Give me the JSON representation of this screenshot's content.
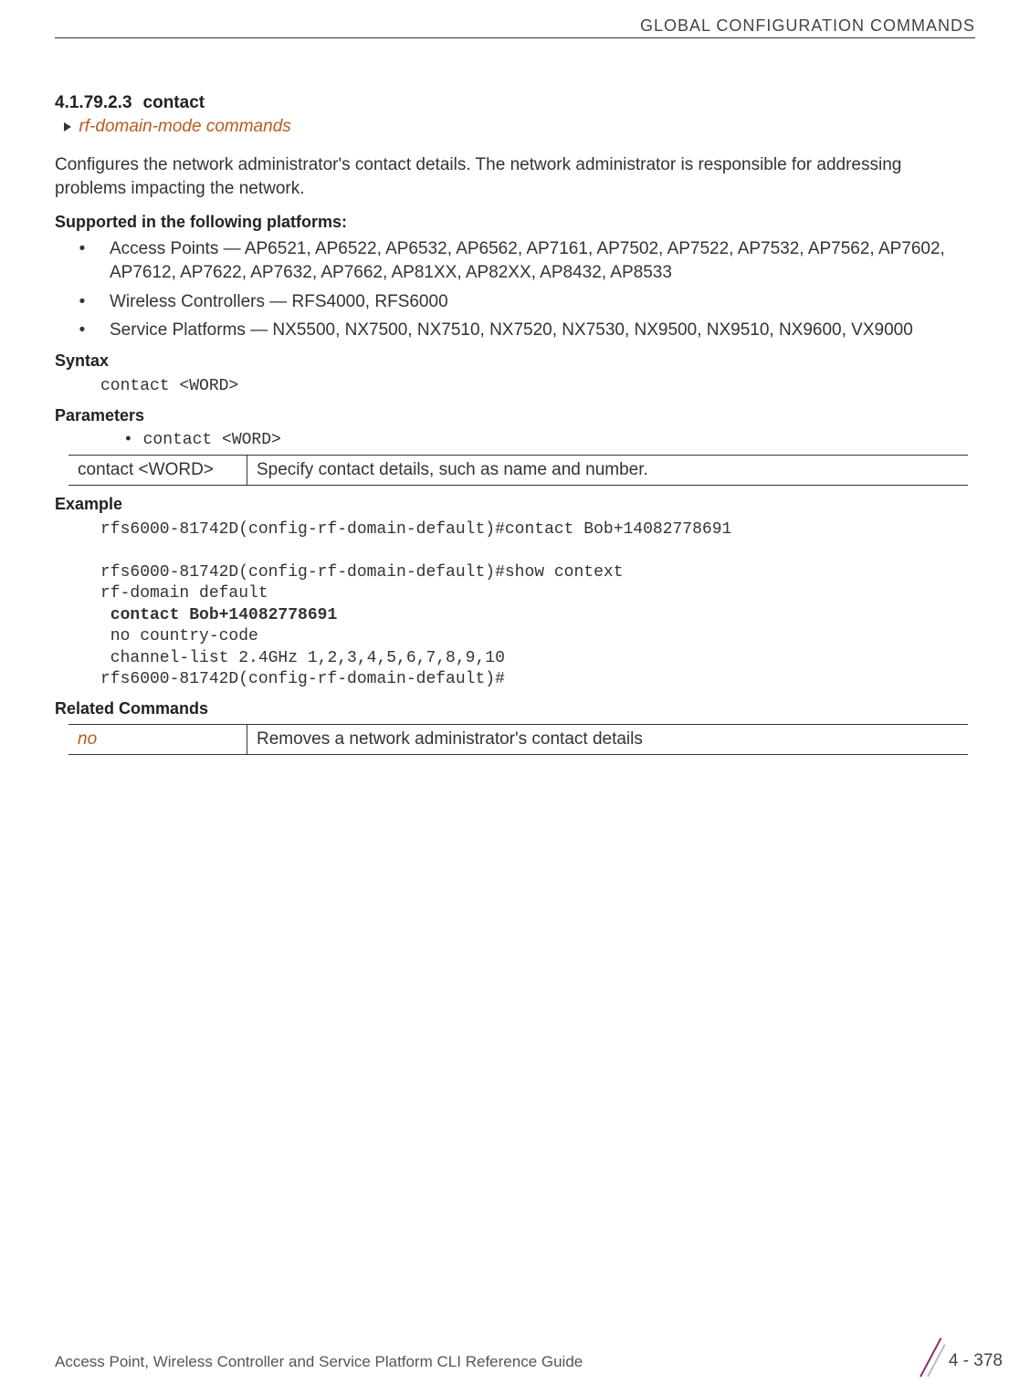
{
  "header": {
    "title": "GLOBAL CONFIGURATION COMMANDS"
  },
  "section": {
    "number": "4.1.79.2.3",
    "title": "contact",
    "breadcrumb": "rf-domain-mode commands",
    "intro": "Configures the network administrator's contact details. The network administrator is responsible for addressing problems impacting the network."
  },
  "supported": {
    "heading": "Supported in the following platforms:",
    "items": [
      "Access Points — AP6521, AP6522, AP6532, AP6562, AP7161, AP7502, AP7522, AP7532, AP7562, AP7602, AP7612, AP7622, AP7632, AP7662, AP81XX, AP82XX, AP8432, AP8533",
      "Wireless Controllers — RFS4000, RFS6000",
      "Service Platforms — NX5500, NX7500, NX7510, NX7520, NX7530, NX9500, NX9510, NX9600, VX9000"
    ]
  },
  "syntax": {
    "heading": "Syntax",
    "code": "contact <WORD>"
  },
  "parameters": {
    "heading": "Parameters",
    "bullet": "• contact <WORD>",
    "table": {
      "left": "contact <WORD>",
      "right": "Specify contact details, such as name and number."
    }
  },
  "example": {
    "heading": "Example",
    "line1": "rfs6000-81742D(config-rf-domain-default)#contact Bob+14082778691",
    "line2": "rfs6000-81742D(config-rf-domain-default)#show context",
    "line3": "rf-domain default",
    "line4_bold": " contact Bob+14082778691",
    "line5": " no country-code",
    "line6": " channel-list 2.4GHz 1,2,3,4,5,6,7,8,9,10",
    "line7": "rfs6000-81742D(config-rf-domain-default)#"
  },
  "related": {
    "heading": "Related Commands",
    "table": {
      "left": "no",
      "right": "Removes a network administrator's contact details"
    }
  },
  "footer": {
    "doc_title": "Access Point, Wireless Controller and Service Platform CLI Reference Guide",
    "page_number": "4 - 378"
  }
}
